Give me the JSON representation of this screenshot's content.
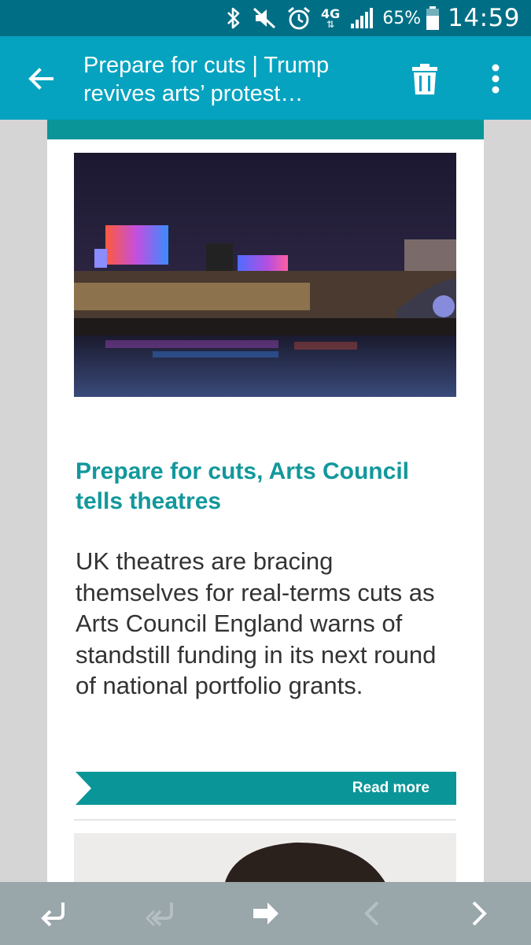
{
  "status_bar": {
    "icons": [
      "bluetooth-icon",
      "vibrate-mute-icon",
      "alarm-icon",
      "network-4g-icon",
      "signal-icon",
      "battery-icon"
    ],
    "network": "4G",
    "battery": "65%",
    "time": "14:59"
  },
  "app_bar": {
    "title_line1": "Prepare for cuts | Trump",
    "title_line2": "revives arts’ protest…",
    "back_icon": "arrow-left-icon",
    "delete_icon": "trash-icon",
    "menu_icon": "more-vert-icon"
  },
  "article": {
    "image_icon": "national-theatre-night-photo",
    "headline": "Prepare for cuts, Arts Council tells theatres",
    "body": "UK theatres are bracing themselves for real-terms cuts as Arts Council England warns of standstill funding in its next round of national portfolio grants.",
    "read_more": "Read more"
  },
  "next_article": {
    "image_icon": "portrait-photo"
  },
  "bottom_bar": {
    "buttons": [
      "reply-icon",
      "reply-all-icon",
      "forward-icon",
      "previous-icon",
      "next-icon"
    ]
  },
  "colors": {
    "status_bar": "#006f86",
    "app_bar": "#05a3c0",
    "accent_teal": "#0a9698",
    "headline": "#12989c",
    "bottom_bar": "#99a6aa"
  }
}
